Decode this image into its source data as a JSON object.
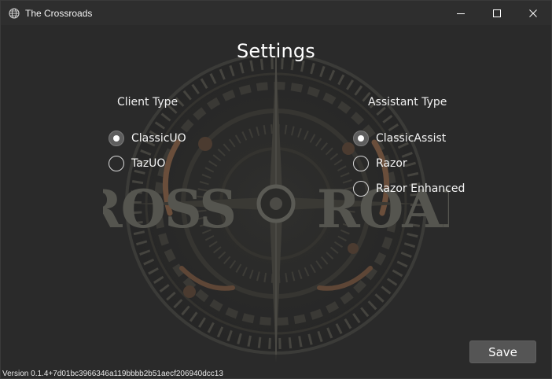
{
  "window": {
    "title": "The Crossroads",
    "icon": "globe-icon",
    "controls": [
      "minimize-icon",
      "maximize-icon",
      "close-icon"
    ]
  },
  "settings": {
    "heading": "Settings",
    "client_type": {
      "label": "Client Type",
      "options": [
        {
          "label": "ClassicUO",
          "selected": true
        },
        {
          "label": "TazUO",
          "selected": false
        }
      ]
    },
    "assistant_type": {
      "label": "Assistant Type",
      "options": [
        {
          "label": "ClassicAssist",
          "selected": true
        },
        {
          "label": "Razor",
          "selected": false
        },
        {
          "label": "Razor Enhanced",
          "selected": false
        }
      ]
    },
    "save_label": "Save"
  },
  "background": {
    "logo_text_left": "CROSS",
    "logo_text_right": "ROADS"
  },
  "footer": {
    "version": "Version 0.1.4+7d01bc3966346a119bbbb2b51aecf206940dcc13"
  },
  "colors": {
    "background": "#2a2a2a",
    "titlebar": "#2e2e2e",
    "button": "#555555",
    "text": "#f0f0f0"
  }
}
